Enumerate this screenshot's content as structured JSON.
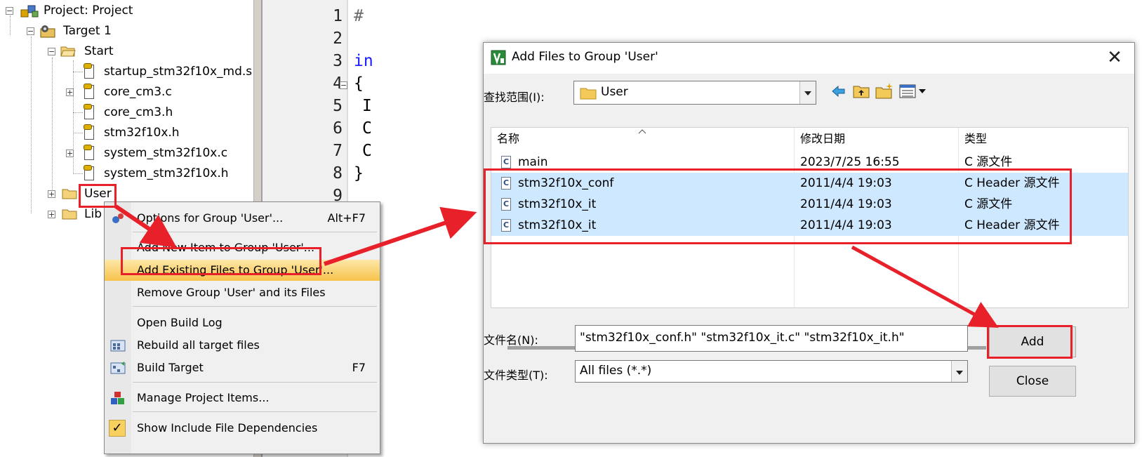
{
  "tree": {
    "project": "Project: Project",
    "target": "Target 1",
    "start_group": "Start",
    "files": [
      "startup_stm32f10x_md.s",
      "core_cm3.c",
      "core_cm3.h",
      "stm32f10x.h",
      "system_stm32f10x.c",
      "system_stm32f10x.h"
    ],
    "user_group": "User",
    "lib_group": "Lib"
  },
  "editor": {
    "line_numbers": [
      "1",
      "2",
      "3",
      "4",
      "5",
      "6",
      "7",
      "8",
      "9"
    ],
    "code_fragments": {
      "l1": "#",
      "l3": "in",
      "l4": "{",
      "l5": "I",
      "l6": "C",
      "l7": "C",
      "l8": "}"
    }
  },
  "context_menu": {
    "items": [
      {
        "label": "Options for Group 'User'...",
        "shortcut": "Alt+F7"
      },
      {
        "label": "Add New  Item to Group 'User'...",
        "shortcut": ""
      },
      {
        "label": "Add Existing Files to Group 'User'...",
        "shortcut": ""
      },
      {
        "label": "Remove Group 'User' and its Files",
        "shortcut": ""
      },
      {
        "label": "Open Build Log",
        "shortcut": ""
      },
      {
        "label": "Rebuild all target files",
        "shortcut": ""
      },
      {
        "label": "Build Target",
        "shortcut": "F7"
      },
      {
        "label": "Manage Project Items...",
        "shortcut": ""
      },
      {
        "label": "Show Include File Dependencies",
        "shortcut": ""
      }
    ]
  },
  "dialog": {
    "title": "Add Files to Group 'User'",
    "look_in_label": "查找范围(I):",
    "look_in_value": "User",
    "columns": [
      "名称",
      "修改日期",
      "类型"
    ],
    "files": [
      {
        "name": "main",
        "date": "2023/7/25 16:55",
        "type": "C 源文件",
        "selected": false
      },
      {
        "name": "stm32f10x_conf",
        "date": "2011/4/4 19:03",
        "type": "C Header 源文件",
        "selected": true
      },
      {
        "name": "stm32f10x_it",
        "date": "2011/4/4 19:03",
        "type": "C 源文件",
        "selected": true
      },
      {
        "name": "stm32f10x_it",
        "date": "2011/4/4 19:03",
        "type": "C Header 源文件",
        "selected": true
      }
    ],
    "filename_label": "文件名(N):",
    "filename_value": "\"stm32f10x_conf.h\" \"stm32f10x_it.c\" \"stm32f10x_it.h\"",
    "filetype_label": "文件类型(T):",
    "filetype_value": "All files (*.*)",
    "add_button": "Add",
    "close_button": "Close",
    "close_glyph": "✕"
  },
  "icons": {
    "file_glyph": "C",
    "checkmark": "✓"
  },
  "colors": {
    "annotation_red": "#e8202a",
    "selection_blue": "#cde8ff",
    "menu_highlight": "#f7c34a"
  }
}
